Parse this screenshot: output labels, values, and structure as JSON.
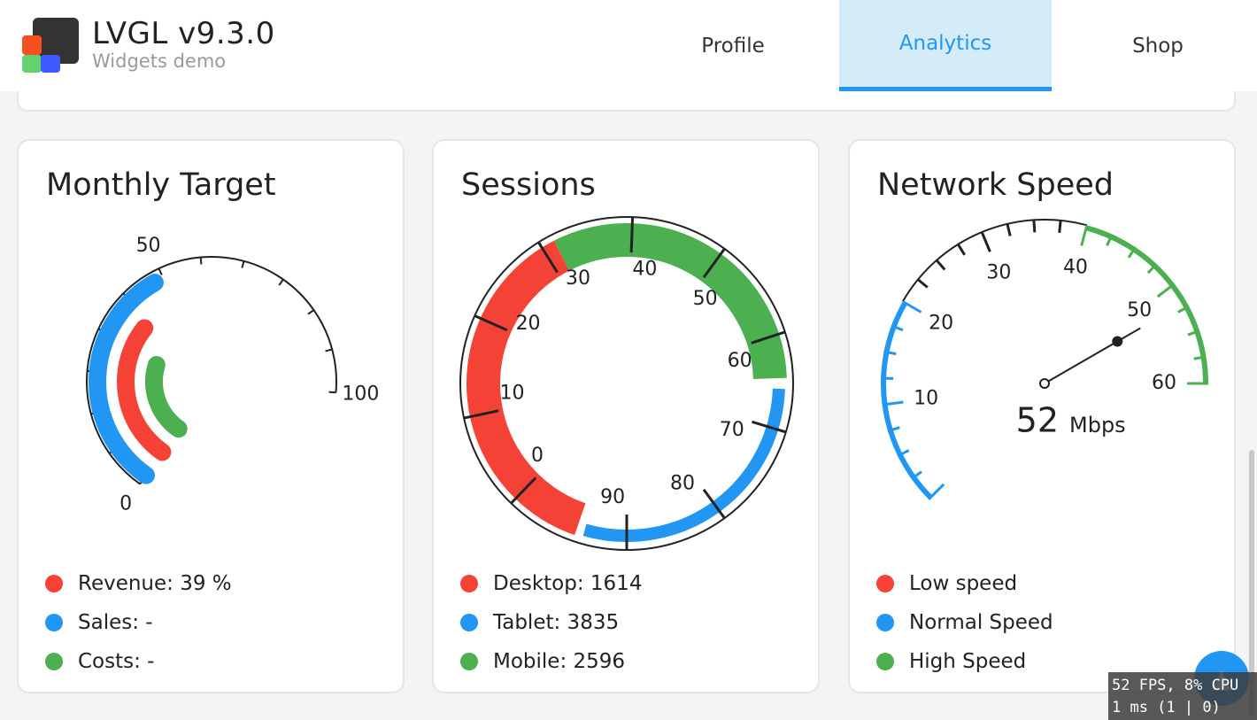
{
  "header": {
    "title": "LVGL v9.3.0",
    "subtitle": "Widgets demo",
    "tabs": [
      {
        "label": "Profile",
        "active": false
      },
      {
        "label": "Analytics",
        "active": true
      },
      {
        "label": "Shop",
        "active": false
      }
    ]
  },
  "colors": {
    "red": "#f44336",
    "blue": "#2196f3",
    "green": "#4caf50",
    "accent": "#2196f3"
  },
  "monthly_target": {
    "title": "Monthly Target",
    "scale": {
      "min": 0,
      "max": 100,
      "labels": [
        "0",
        "50",
        "100"
      ]
    },
    "arcs": [
      {
        "name": "Sales",
        "value": 48,
        "color": "#2196f3"
      },
      {
        "name": "Revenue",
        "value": 39,
        "color": "#f44336"
      },
      {
        "name": "Costs",
        "value": 30,
        "color": "#4caf50"
      }
    ],
    "legend": [
      {
        "text": "Revenue: 39 %",
        "color": "#f44336"
      },
      {
        "text": "Sales: -",
        "color": "#2196f3"
      },
      {
        "text": "Costs: -",
        "color": "#4caf50"
      }
    ]
  },
  "sessions": {
    "title": "Sessions",
    "scale_labels": [
      "0",
      "10",
      "20",
      "30",
      "40",
      "50",
      "60",
      "70",
      "80",
      "90"
    ],
    "legend": [
      {
        "text": "Desktop: 1614",
        "color": "#f44336"
      },
      {
        "text": "Tablet: 3835",
        "color": "#2196f3"
      },
      {
        "text": "Mobile: 2596",
        "color": "#4caf50"
      }
    ]
  },
  "network_speed": {
    "title": "Network Speed",
    "value": "52",
    "unit": "Mbps",
    "scale_labels": [
      "10",
      "20",
      "30",
      "40",
      "50",
      "60"
    ],
    "legend": [
      {
        "text": "Low speed",
        "color": "#f44336"
      },
      {
        "text": "Normal Speed",
        "color": "#2196f3"
      },
      {
        "text": "High Speed",
        "color": "#4caf50"
      }
    ]
  },
  "perf": {
    "line1": "52 FPS, 8% CPU",
    "line2": "1 ms (1 | 0)"
  }
}
